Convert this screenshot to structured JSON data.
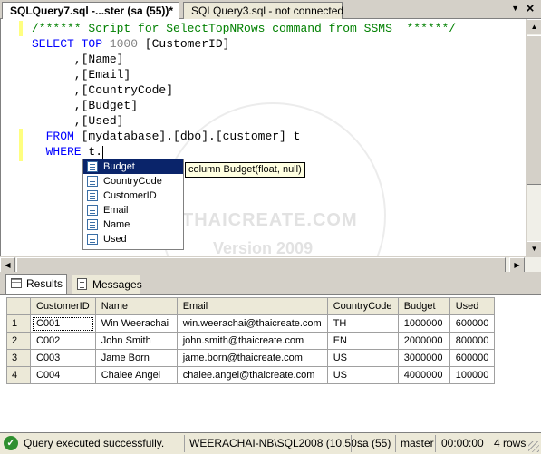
{
  "tabs": {
    "active_label": "SQLQuery7.sql -...ster (sa (55))*",
    "inactive_label": "SQLQuery3.sql - not connected",
    "close_glyph": "×",
    "arrow_glyph": "▼"
  },
  "editor": {
    "lines": [
      {
        "comment": "/****** Script for SelectTopNRows command from SSMS  ******/"
      },
      {
        "kw": "SELECT TOP",
        "num": " 1000 ",
        "rest": "[CustomerID]"
      },
      {
        "rest": "      ,[Name]"
      },
      {
        "rest": "      ,[Email]"
      },
      {
        "rest": "      ,[CountryCode]"
      },
      {
        "rest": "      ,[Budget]"
      },
      {
        "rest": "      ,[Used]"
      },
      {
        "kw": "  FROM ",
        "rest": "[mydatabase].[dbo].[customer] t"
      },
      {
        "kw": "  WHERE ",
        "rest": "t."
      }
    ]
  },
  "autocomplete": {
    "items": [
      "Budget",
      "CountryCode",
      "CustomerID",
      "Email",
      "Name",
      "Used"
    ],
    "selected_index": 0,
    "tooltip": "column Budget(float, null)"
  },
  "watermark": {
    "line1": "THAICREATE.COM",
    "line2": "Version 2009"
  },
  "result_tabs": {
    "results_label": "Results",
    "messages_label": "Messages"
  },
  "grid": {
    "columns": [
      "CustomerID",
      "Name",
      "Email",
      "CountryCode",
      "Budget",
      "Used"
    ],
    "rows": [
      {
        "num": "1",
        "cells": [
          "C001",
          "Win Weerachai",
          "win.weerachai@thaicreate.com",
          "TH",
          "1000000",
          "600000"
        ]
      },
      {
        "num": "2",
        "cells": [
          "C002",
          "John Smith",
          "john.smith@thaicreate.com",
          "EN",
          "2000000",
          "800000"
        ]
      },
      {
        "num": "3",
        "cells": [
          "C003",
          "Jame Born",
          "jame.born@thaicreate.com",
          "US",
          "3000000",
          "600000"
        ]
      },
      {
        "num": "4",
        "cells": [
          "C004",
          "Chalee Angel",
          "chalee.angel@thaicreate.com",
          "US",
          "4000000",
          "100000"
        ]
      }
    ]
  },
  "status": {
    "message": "Query executed successfully.",
    "server": "WEERACHAI-NB\\SQL2008 (10.50...",
    "user": "sa (55)",
    "database": "master",
    "elapsed": "00:00:00",
    "rows": "4 rows"
  }
}
